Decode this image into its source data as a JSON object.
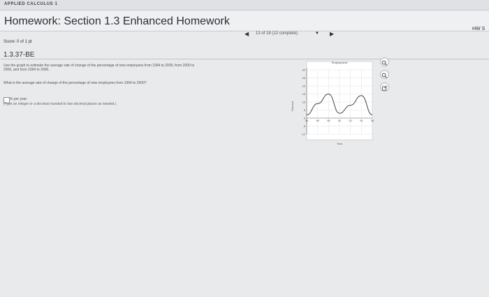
{
  "header": {
    "course_title": "APPLIED CALCULUS 1",
    "page_title": "Homework: Section 1.3 Enhanced Homework",
    "right_label": "HW S"
  },
  "nav": {
    "status": "13 of 18 (12 complete)"
  },
  "score": {
    "text": "Score: 0 of 1 pt"
  },
  "question": {
    "id": "1.3.37-BE",
    "instruction_line1": "Use the graph to estimate the average rate of change of the percentage of new employees from 1994 to 2000, from 2000 to",
    "instruction_line2": "2006, and from 1994 to 2006.",
    "prompt": "What is the average rate of change of the percentage of new employees from 1994 to 2000?",
    "answer_unit": "% per year",
    "hint": "(Type an integer or a decimal rounded to two decimal places as needed.)"
  },
  "chart_data": {
    "type": "line",
    "title": "Employment",
    "xlabel": "Year",
    "ylabel": "Percent",
    "x": [
      1994,
      1996,
      1998,
      2000,
      2002,
      2004,
      2006
    ],
    "x_tick_labels": [
      "94",
      "96",
      "98",
      "00",
      "02",
      "04",
      "06"
    ],
    "y_ticks": [
      -10,
      -5,
      0,
      5,
      10,
      15,
      20,
      25,
      30
    ],
    "ylim": [
      -10,
      30
    ],
    "series": [
      {
        "values": [
          2,
          9,
          15,
          3,
          8,
          14,
          2
        ]
      }
    ],
    "grid": true
  },
  "tools": {
    "icons": [
      "zoom-in-icon",
      "zoom-out-icon",
      "popout-icon"
    ]
  }
}
